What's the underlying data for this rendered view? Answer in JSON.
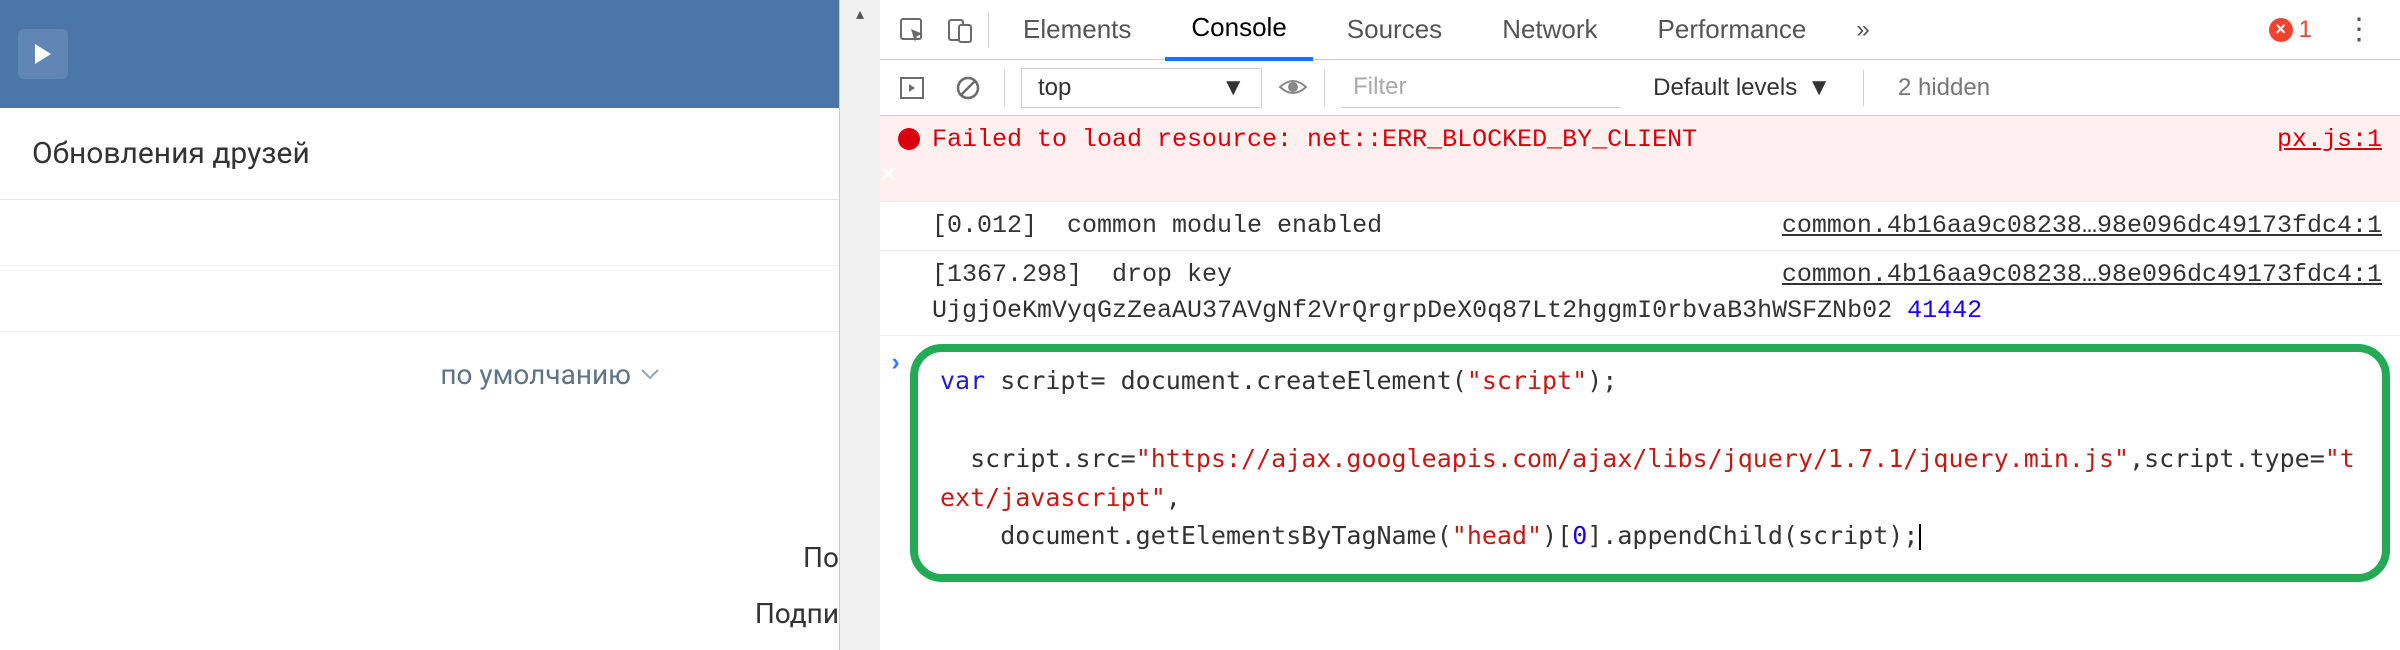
{
  "left": {
    "page_title": "Обновления друзей",
    "sort_label": "по умолчанию",
    "col_header_1": "По",
    "col_header_2": "Подпи"
  },
  "devtools": {
    "tabs": [
      "Elements",
      "Console",
      "Sources",
      "Network",
      "Performance"
    ],
    "active_tab": "Console",
    "errors_count": "1",
    "toolbar": {
      "context": "top",
      "filter_placeholder": "Filter",
      "levels_label": "Default levels",
      "hidden_label": "2 hidden"
    },
    "log": {
      "err_msg": "Failed to load resource: net::ERR_BLOCKED_BY_CLIENT",
      "err_src": "px.js:1",
      "row2_msg": "[0.012]  common module enabled",
      "row2_src": "common.4b16aa9c08238…98e096dc49173fdc4:1",
      "row3_line1": "[1367.298]  drop key",
      "row3_src": "common.4b16aa9c08238…98e096dc49173fdc4:1",
      "row3_line2a": "UjgjOeKmVyqGzZeaAU37AVgNf2VrQrgrpDeX0q87Lt2hggmI0rbvaB3hWSFZNb02 ",
      "row3_line2b": "41442"
    },
    "input": {
      "kw_var": "var",
      "ident_script": " script= document.createElement(",
      "str_script": "\"script\"",
      "close1": ");",
      "line3a": "  script.src=",
      "str_url": "\"https://ajax.googleapis.com/ajax/libs/jquery/1.7.1/jquery.min.js\"",
      "line3b": ",script.type=",
      "str_type": "\"text/javascript\"",
      "line3c": ",",
      "line4a": "    document.getElementsByTagName(",
      "str_head": "\"head\"",
      "line4b": ")[",
      "num0": "0",
      "line4c": "].appendChild(script);"
    }
  }
}
